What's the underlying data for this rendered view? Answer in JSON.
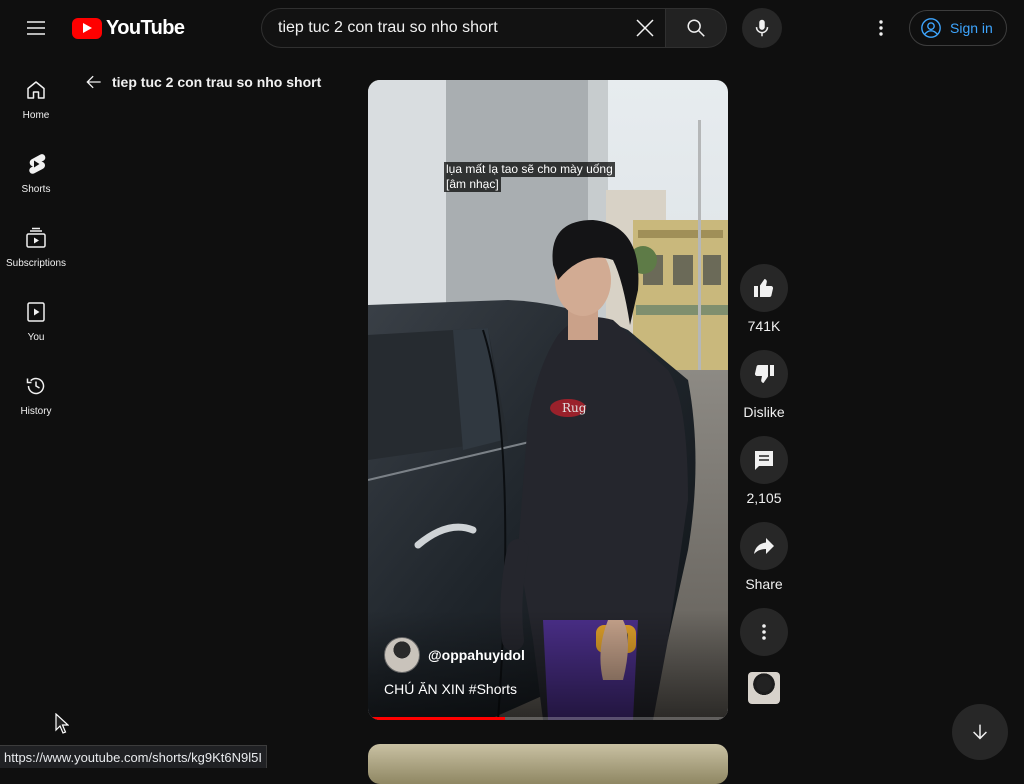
{
  "header": {
    "logo_text": "YouTube",
    "search_value": "tiep tuc 2 con trau so nho short",
    "signin_label": "Sign in"
  },
  "sidebar": {
    "items": [
      {
        "label": "Home",
        "icon": "home-icon"
      },
      {
        "label": "Shorts",
        "icon": "shorts-icon"
      },
      {
        "label": "Subscriptions",
        "icon": "subscriptions-icon"
      },
      {
        "label": "You",
        "icon": "you-icon"
      },
      {
        "label": "History",
        "icon": "history-icon"
      }
    ]
  },
  "back": {
    "title": "tiep tuc 2 con trau so nho short"
  },
  "video": {
    "caption_line1": "lụa mất lạ tao sẽ cho mày uống",
    "caption_line2": "[âm nhạc]",
    "channel_name": "@oppahuyidol",
    "title": "CHÚ ĂN XIN #Shorts",
    "progress": 0.38
  },
  "actions": {
    "like_count": "741K",
    "dislike_label": "Dislike",
    "comment_count": "2,105",
    "share_label": "Share"
  },
  "status_url": "https://www.youtube.com/shorts/kg9Kt6N9l5I",
  "colors": {
    "background": "#0f0f0f",
    "brand_red": "#ff0000",
    "link_blue": "#3ea6ff",
    "button_bg": "#272727"
  }
}
